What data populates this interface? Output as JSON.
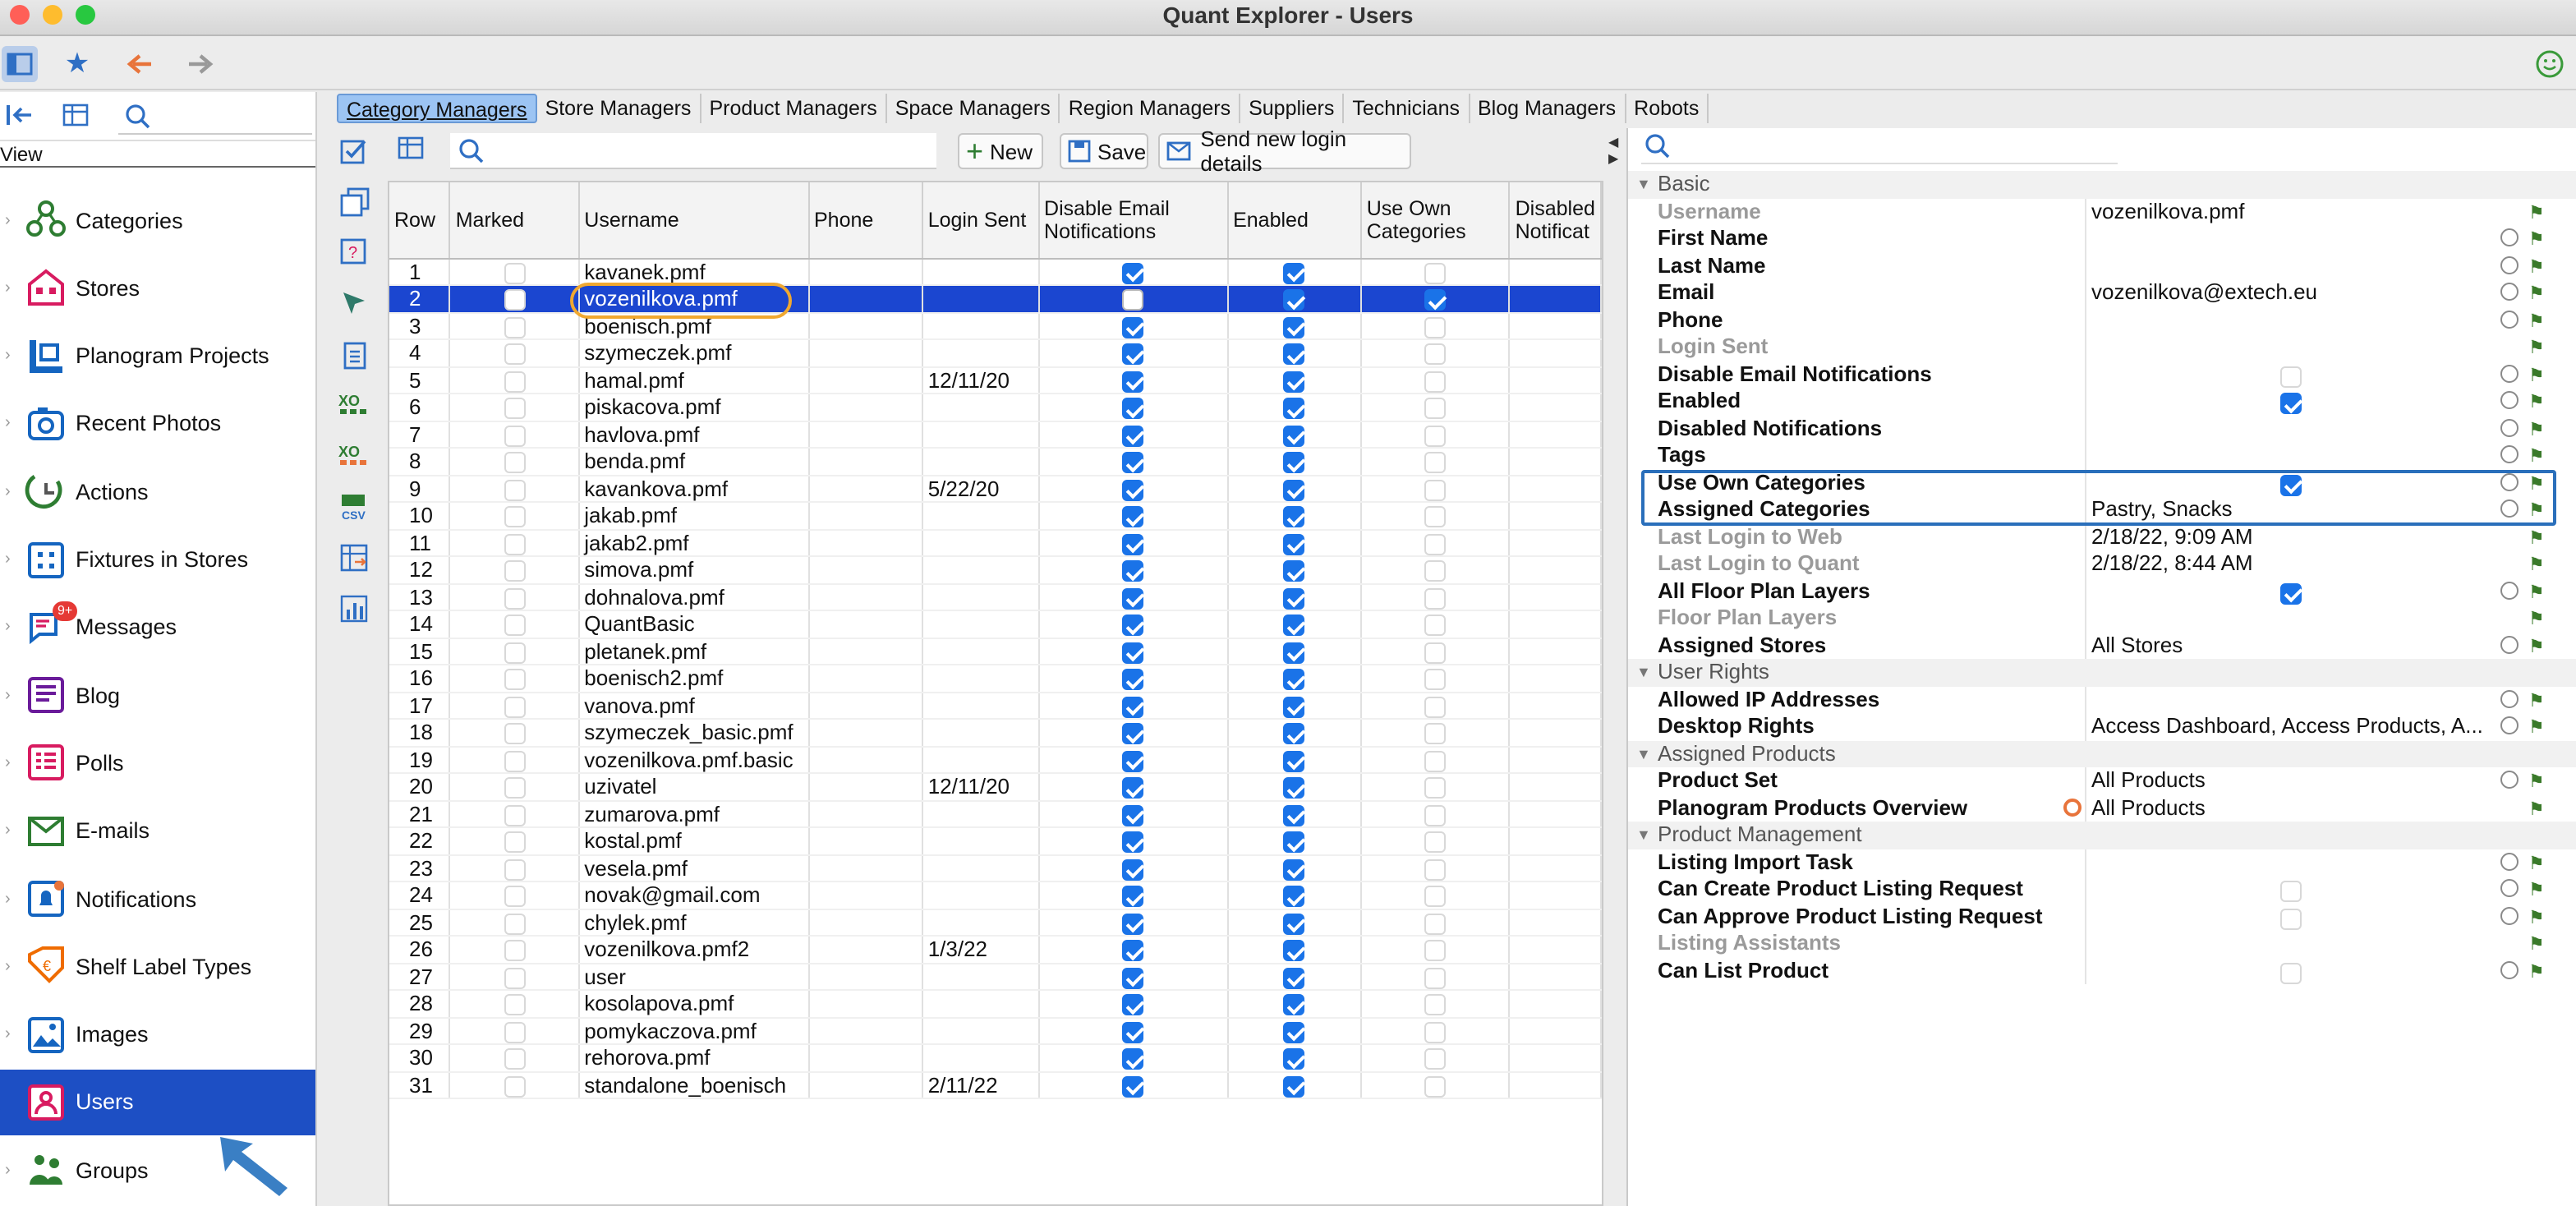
{
  "window": {
    "title": "Quant Explorer - Users"
  },
  "sidebar": {
    "view_label": "View",
    "items": [
      {
        "label": "Categories",
        "icon": "categories-icon",
        "color": "#2e7d32"
      },
      {
        "label": "Stores",
        "icon": "store-icon",
        "color": "#d81b60"
      },
      {
        "label": "Planogram Projects",
        "icon": "planogram-icon",
        "color": "#1565c0"
      },
      {
        "label": "Recent Photos",
        "icon": "camera-icon",
        "color": "#1565c0"
      },
      {
        "label": "Actions",
        "icon": "actions-icon",
        "color": "#2e7d32"
      },
      {
        "label": "Fixtures in Stores",
        "icon": "fixtures-icon",
        "color": "#1565c0"
      },
      {
        "label": "Messages",
        "icon": "messages-icon",
        "color": "#1565c0",
        "badge": "9+"
      },
      {
        "label": "Blog",
        "icon": "blog-icon",
        "color": "#6a1b9a"
      },
      {
        "label": "Polls",
        "icon": "polls-icon",
        "color": "#d81b60"
      },
      {
        "label": "E-mails",
        "icon": "email-icon",
        "color": "#2e7d32"
      },
      {
        "label": "Notifications",
        "icon": "notifications-icon",
        "color": "#1565c0"
      },
      {
        "label": "Shelf Label Types",
        "icon": "shelf-label-icon",
        "color": "#ef6c00"
      },
      {
        "label": "Images",
        "icon": "images-icon",
        "color": "#1565c0"
      },
      {
        "label": "Users",
        "icon": "users-icon",
        "color": "#d81b60",
        "selected": true
      },
      {
        "label": "Groups",
        "icon": "groups-icon",
        "color": "#2e7d32"
      }
    ]
  },
  "tabs": [
    "Category Managers",
    "Store Managers",
    "Product Managers",
    "Space Managers",
    "Region Managers",
    "Suppliers",
    "Technicians",
    "Blog Managers",
    "Robots"
  ],
  "grid_toolbar": {
    "new_label": "New",
    "save_label": "Save",
    "send_label": "Send new login details",
    "search_placeholder": ""
  },
  "grid": {
    "columns": [
      "Row",
      "Marked",
      "Username",
      "Phone",
      "Login Sent",
      "Disable Email Notifications",
      "Enabled",
      "Use Own Categories",
      "Disabled Notificat"
    ],
    "rows": [
      {
        "row": "1",
        "user": "kavanek.pmf",
        "login": "",
        "den": true,
        "en": true,
        "own": false
      },
      {
        "row": "2",
        "user": "vozenilkova.pmf",
        "login": "",
        "den": false,
        "en": true,
        "own": true,
        "selected": true
      },
      {
        "row": "3",
        "user": "boenisch.pmf",
        "login": "",
        "den": true,
        "en": true,
        "own": false
      },
      {
        "row": "4",
        "user": "szymeczek.pmf",
        "login": "",
        "den": true,
        "en": true,
        "own": false
      },
      {
        "row": "5",
        "user": "hamal.pmf",
        "login": "12/11/20",
        "den": true,
        "en": true,
        "own": false
      },
      {
        "row": "6",
        "user": "piskacova.pmf",
        "login": "",
        "den": true,
        "en": true,
        "own": false
      },
      {
        "row": "7",
        "user": "havlova.pmf",
        "login": "",
        "den": true,
        "en": true,
        "own": false
      },
      {
        "row": "8",
        "user": "benda.pmf",
        "login": "",
        "den": true,
        "en": true,
        "own": false
      },
      {
        "row": "9",
        "user": "kavankova.pmf",
        "login": "5/22/20",
        "den": true,
        "en": true,
        "own": false
      },
      {
        "row": "10",
        "user": "jakab.pmf",
        "login": "",
        "den": true,
        "en": true,
        "own": false
      },
      {
        "row": "11",
        "user": "jakab2.pmf",
        "login": "",
        "den": true,
        "en": true,
        "own": false
      },
      {
        "row": "12",
        "user": "simova.pmf",
        "login": "",
        "den": true,
        "en": true,
        "own": false
      },
      {
        "row": "13",
        "user": "dohnalova.pmf",
        "login": "",
        "den": true,
        "en": true,
        "own": false
      },
      {
        "row": "14",
        "user": "QuantBasic",
        "login": "",
        "den": true,
        "en": true,
        "own": false
      },
      {
        "row": "15",
        "user": "pletanek.pmf",
        "login": "",
        "den": true,
        "en": true,
        "own": false
      },
      {
        "row": "16",
        "user": "boenisch2.pmf",
        "login": "",
        "den": true,
        "en": true,
        "own": false
      },
      {
        "row": "17",
        "user": "vanova.pmf",
        "login": "",
        "den": true,
        "en": true,
        "own": false
      },
      {
        "row": "18",
        "user": "szymeczek_basic.pmf",
        "login": "",
        "den": true,
        "en": true,
        "own": false
      },
      {
        "row": "19",
        "user": "vozenilkova.pmf.basic",
        "login": "",
        "den": true,
        "en": true,
        "own": false
      },
      {
        "row": "20",
        "user": "uzivatel",
        "login": "12/11/20",
        "den": true,
        "en": true,
        "own": false
      },
      {
        "row": "21",
        "user": "zumarova.pmf",
        "login": "",
        "den": true,
        "en": true,
        "own": false
      },
      {
        "row": "22",
        "user": "kostal.pmf",
        "login": "",
        "den": true,
        "en": true,
        "own": false
      },
      {
        "row": "23",
        "user": "vesela.pmf",
        "login": "",
        "den": true,
        "en": true,
        "own": false
      },
      {
        "row": "24",
        "user": "novak@gmail.com",
        "login": "",
        "den": true,
        "en": true,
        "own": false
      },
      {
        "row": "25",
        "user": "chylek.pmf",
        "login": "",
        "den": true,
        "en": true,
        "own": false
      },
      {
        "row": "26",
        "user": "vozenilkova.pmf2",
        "login": "1/3/22",
        "den": true,
        "en": true,
        "own": false
      },
      {
        "row": "27",
        "user": "user",
        "login": "",
        "den": true,
        "en": true,
        "own": false
      },
      {
        "row": "28",
        "user": "kosolapova.pmf",
        "login": "",
        "den": true,
        "en": true,
        "own": false
      },
      {
        "row": "29",
        "user": "pomykaczova.pmf",
        "login": "",
        "den": true,
        "en": true,
        "own": false
      },
      {
        "row": "30",
        "user": "rehorova.pmf",
        "login": "",
        "den": true,
        "en": true,
        "own": false
      },
      {
        "row": "31",
        "user": "standalone_boenisch",
        "login": "2/11/22",
        "den": true,
        "en": true,
        "own": false
      }
    ]
  },
  "properties": [
    {
      "type": "group",
      "label": "Basic"
    },
    {
      "label": "Username",
      "value": "vozenilkova.pmf",
      "dim": true,
      "icons": 1
    },
    {
      "label": "First Name",
      "value": "",
      "icons": 2
    },
    {
      "label": "Last Name",
      "value": "",
      "icons": 2
    },
    {
      "label": "Email",
      "value": "vozenilkova@extech.eu",
      "icons": 2
    },
    {
      "label": "Phone",
      "value": "",
      "icons": 2
    },
    {
      "label": "Login Sent",
      "value": "",
      "dim": true,
      "icons": 1
    },
    {
      "label": "Disable Email Notifications",
      "check": false,
      "icons": 2
    },
    {
      "label": "Enabled",
      "check": true,
      "icons": 2
    },
    {
      "label": "Disabled Notifications",
      "value": "",
      "icons": 2
    },
    {
      "label": "Tags",
      "value": "",
      "icons": 2
    },
    {
      "label": "Use Own Categories",
      "check": true,
      "icons": 2
    },
    {
      "label": "Assigned Categories",
      "value": "Pastry, Snacks",
      "icons": 2
    },
    {
      "label": "Last Login to Web",
      "value": "2/18/22, 9:09 AM",
      "dim": true,
      "icons": 1
    },
    {
      "label": "Last Login to Quant",
      "value": "2/18/22, 8:44 AM",
      "dim": true,
      "icons": 1
    },
    {
      "label": "All Floor Plan Layers",
      "check": true,
      "icons": 2
    },
    {
      "label": "Floor Plan Layers",
      "value": "",
      "dim": true,
      "icons": 1
    },
    {
      "label": "Assigned Stores",
      "value": "All Stores",
      "icons": 2
    },
    {
      "type": "group",
      "label": "User Rights"
    },
    {
      "label": "Allowed IP Addresses",
      "value": "",
      "icons": 2
    },
    {
      "label": "Desktop Rights",
      "value": "Access Dashboard, Access Products, A...",
      "icons": 2
    },
    {
      "type": "group",
      "label": "Assigned Products"
    },
    {
      "label": "Product Set",
      "value": "All Products",
      "icons": 2
    },
    {
      "label": "Planogram Products Overview",
      "value": "All Products",
      "icons": 1,
      "orange": true
    },
    {
      "type": "group",
      "label": "Product Management"
    },
    {
      "label": "Listing Import Task",
      "value": "",
      "icons": 2
    },
    {
      "label": "Can Create Product Listing Request",
      "check": false,
      "icons": 2
    },
    {
      "label": "Can Approve Product Listing Request",
      "check": false,
      "icons": 2
    },
    {
      "label": "Listing Assistants",
      "value": "",
      "dim": true,
      "icons": 1
    },
    {
      "label": "Can List Product",
      "check": false,
      "icons": 2
    }
  ]
}
